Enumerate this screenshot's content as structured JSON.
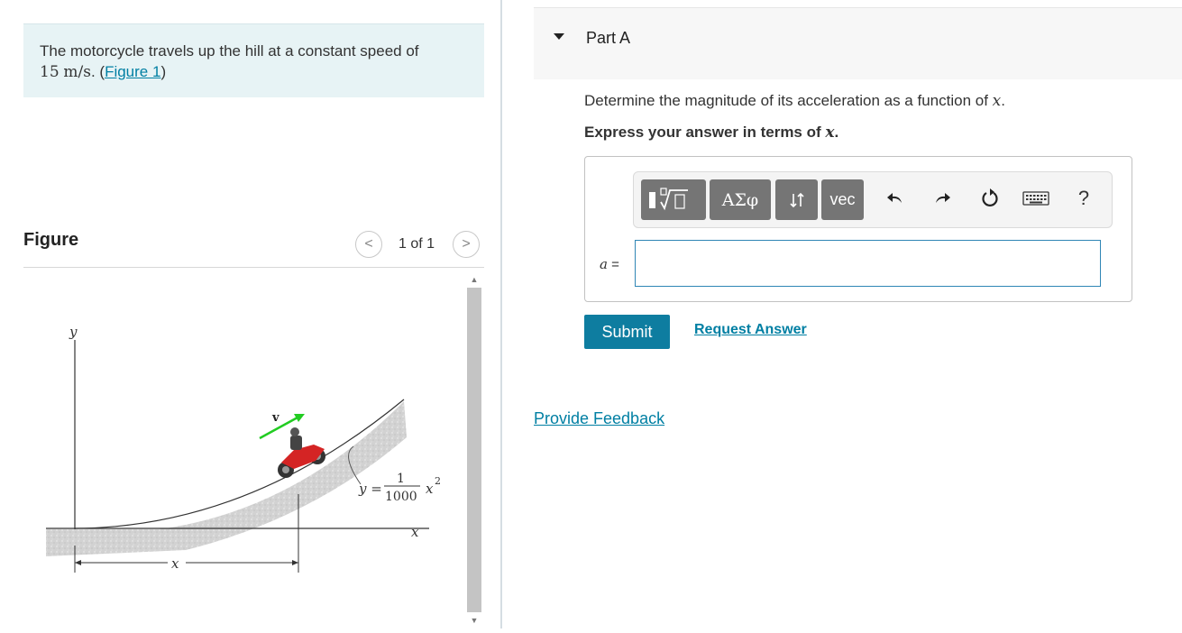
{
  "problem": {
    "text_before": "The motorcycle travels up the hill at a constant speed of",
    "speed_value": "15",
    "speed_unit": "m/s",
    "text_after": ". (",
    "figure_link": "Figure 1",
    "close_paren": ")"
  },
  "figure": {
    "title": "Figure",
    "pager_text": "1 of 1",
    "prev_glyph": "<",
    "next_glyph": ">",
    "labels": {
      "y_axis": "y",
      "x_axis": "x",
      "x_dimension": "x",
      "velocity": "v",
      "eq_lhs": "y =",
      "eq_numerator": "1",
      "eq_denominator": "1000",
      "eq_var": "x",
      "eq_exp": "2"
    }
  },
  "part": {
    "title": "Part A",
    "question_before": "Determine the magnitude of its acceleration as a function of ",
    "question_var": "x",
    "question_after": ".",
    "instruction_before": "Express your answer in terms of ",
    "instruction_var": "x",
    "instruction_after": "."
  },
  "toolbar": {
    "greek_label": "ΑΣφ",
    "vec_label": "vec",
    "help_label": "?",
    "icons": [
      "template-icon",
      "sort-icon",
      "undo-icon",
      "redo-icon",
      "reset-icon",
      "keyboard-icon"
    ]
  },
  "answer": {
    "var": "a",
    "eq": "=",
    "value": "",
    "placeholder": ""
  },
  "buttons": {
    "submit": "Submit",
    "request_answer": "Request Answer",
    "provide_feedback": "Provide Feedback"
  },
  "colors": {
    "accent": "#0e7da0",
    "link": "#007fa3",
    "problem_bg": "#e7f3f5",
    "velocity_arrow": "#22cc22",
    "toolbar_button": "#757575"
  }
}
